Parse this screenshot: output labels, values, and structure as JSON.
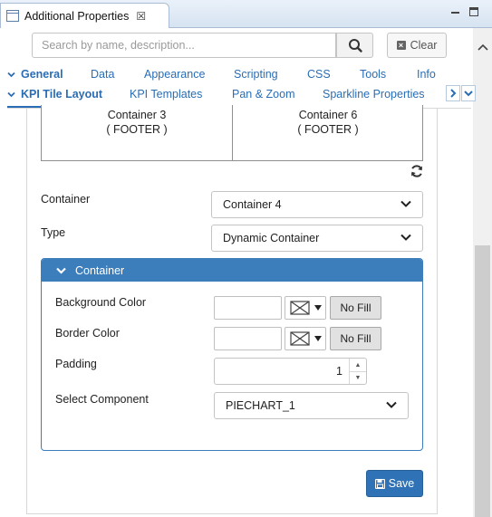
{
  "view": {
    "title": "Additional Properties",
    "close_glyph": "☒"
  },
  "search": {
    "placeholder": "Search by name, description...",
    "value": "",
    "clear_label": "Clear"
  },
  "tabs_row1": [
    {
      "label": "General",
      "active": true
    },
    {
      "label": "Data"
    },
    {
      "label": "Appearance"
    },
    {
      "label": "Scripting"
    },
    {
      "label": "CSS"
    },
    {
      "label": "Tools"
    },
    {
      "label": "Info"
    }
  ],
  "tabs_row2": [
    {
      "label": "KPI Tile Layout",
      "active": true
    },
    {
      "label": "KPI Templates"
    },
    {
      "label": "Pan & Zoom"
    },
    {
      "label": "Sparkline Properties"
    }
  ],
  "preview": {
    "left": {
      "name": "Container 3",
      "role": "( FOOTER )"
    },
    "right": {
      "name": "Container 6",
      "role": "( FOOTER )"
    }
  },
  "form": {
    "container_label": "Container",
    "container_value": "Container 4",
    "type_label": "Type",
    "type_value": "Dynamic Container"
  },
  "section": {
    "title": "Container",
    "background_color_label": "Background Color",
    "border_color_label": "Border Color",
    "no_fill_label": "No Fill",
    "padding_label": "Padding",
    "padding_value": "1",
    "component_label": "Select Component",
    "component_value": "PIECHART_1"
  },
  "actions": {
    "save_label": "Save"
  },
  "colors": {
    "accent": "#2a6db4",
    "header_blue": "#3c7dbc",
    "save_blue": "#2f72b5"
  }
}
